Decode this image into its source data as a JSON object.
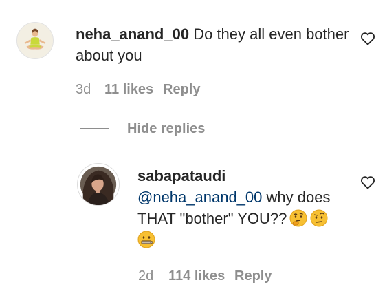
{
  "comments": [
    {
      "username": "neha_anand_00",
      "text": "Do they all even bother about you",
      "time": "3d",
      "likes": "11 likes",
      "reply_label": "Reply"
    }
  ],
  "replies_toggle": {
    "label": "Hide replies"
  },
  "reply": {
    "username": "sabapataudi",
    "mention": "@neha_anand_00",
    "text_line1": " why does",
    "text_line2": "THAT \"bother\" YOU??",
    "emojis": [
      "thinking-face",
      "face-with-raised-eyebrow",
      "zipper-mouth-face"
    ],
    "time": "2d",
    "likes": "114 likes",
    "reply_label": "Reply"
  },
  "colors": {
    "text": "#262626",
    "secondary": "#8e8e8e",
    "mention": "#00376b"
  }
}
